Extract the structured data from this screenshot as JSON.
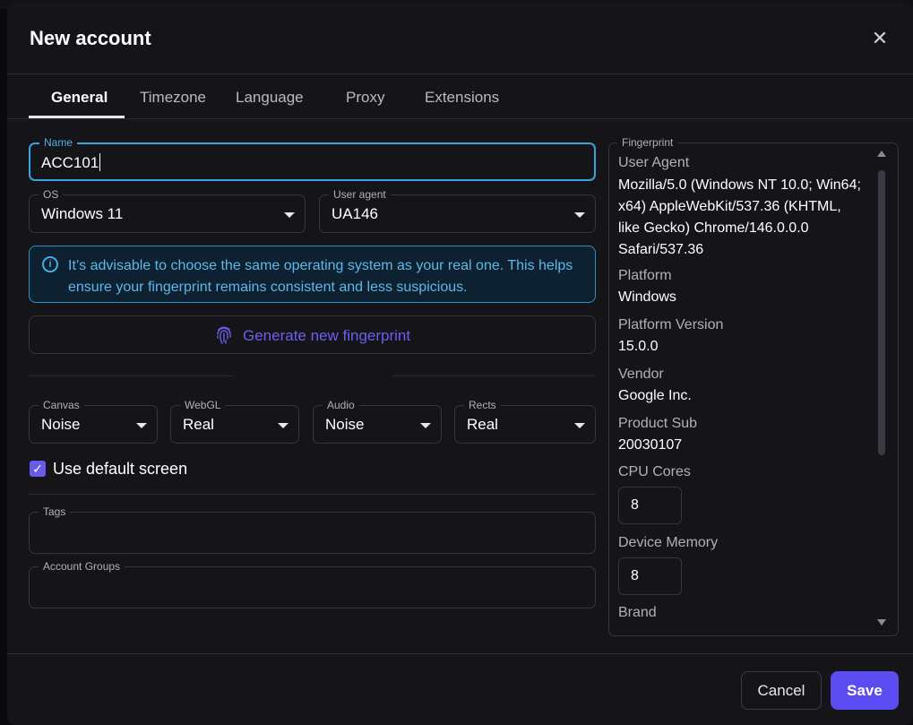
{
  "dialog": {
    "title": "New account",
    "close_icon": "close-icon"
  },
  "tabs": [
    {
      "label": "General",
      "active": true
    },
    {
      "label": "Timezone",
      "active": false
    },
    {
      "label": "Language",
      "active": false
    },
    {
      "label": "Proxy",
      "active": false
    },
    {
      "label": "Extensions",
      "active": false
    }
  ],
  "form": {
    "name": {
      "label": "Name",
      "value": "ACC101"
    },
    "os": {
      "label": "OS",
      "value": "Windows 11"
    },
    "user_agent": {
      "label": "User agent",
      "value": "UA146"
    },
    "info": "It’s advisable to choose the same operating system as your real one. This helps ensure your fingerprint remains consistent and less suspicious.",
    "generate_label": "Generate new fingerprint",
    "canvas": {
      "label": "Canvas",
      "value": "Noise"
    },
    "webgl": {
      "label": "WebGL",
      "value": "Real"
    },
    "audio": {
      "label": "Audio",
      "value": "Noise"
    },
    "rects": {
      "label": "Rects",
      "value": "Real"
    },
    "default_screen": {
      "label": "Use default screen",
      "checked": true
    },
    "tags": {
      "label": "Tags",
      "value": ""
    },
    "account_groups": {
      "label": "Account Groups",
      "value": ""
    }
  },
  "fingerprint": {
    "label": "Fingerprint",
    "user_agent_label": "User Agent",
    "user_agent_value": "Mozilla/5.0 (Windows NT 10.0; Win64; x64) AppleWebKit/537.36 (KHTML, like Gecko) Chrome/146.0.0.0 Safari/537.36",
    "platform_label": "Platform",
    "platform_value": "Windows",
    "platform_version_label": "Platform Version",
    "platform_version_value": "15.0.0",
    "vendor_label": "Vendor",
    "vendor_value": "Google Inc.",
    "product_sub_label": "Product Sub",
    "product_sub_value": "20030107",
    "cpu_cores_label": "CPU Cores",
    "cpu_cores_value": "8",
    "device_memory_label": "Device Memory",
    "device_memory_value": "8",
    "brand_label": "Brand"
  },
  "footer": {
    "cancel_label": "Cancel",
    "save_label": "Save"
  },
  "colors": {
    "accent": "#5a4cf0",
    "info_blue": "#3aa3d9",
    "background": "#151519"
  }
}
